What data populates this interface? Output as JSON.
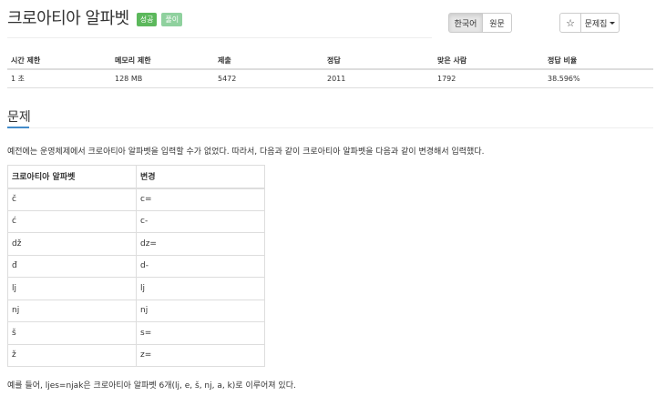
{
  "problem": {
    "title": "크로아티아 알파벳",
    "badges": {
      "success": "성공",
      "solved": "풀이"
    }
  },
  "language": {
    "active": "한국어",
    "original": "원문"
  },
  "tools": {
    "star_icon": "☆",
    "problem_set_label": "문제집"
  },
  "info": {
    "headers": [
      "시간 제한",
      "메모리 제한",
      "제출",
      "정답",
      "맞은 사람",
      "정답 비율"
    ],
    "values": [
      "1 초",
      "128 MB",
      "5472",
      "2011",
      "1792",
      "38.596%"
    ]
  },
  "section": {
    "title": "문제"
  },
  "description": "예전에는 운영체제에서 크로아티아 알파벳을 입력할 수가 없었다. 따라서, 다음과 같이 크로아티아 알파벳을 다음과 같이 변경해서 입력했다.",
  "alphabet_table": {
    "headers": [
      "크로아티아 알파벳",
      "변경"
    ],
    "rows": [
      [
        "č",
        "c="
      ],
      [
        "ć",
        "c-"
      ],
      [
        "dž",
        "dz="
      ],
      [
        "đ",
        "d-"
      ],
      [
        "lj",
        "lj"
      ],
      [
        "nj",
        "nj"
      ],
      [
        "š",
        "s="
      ],
      [
        "ž",
        "z="
      ]
    ]
  },
  "example_text": "예를 들어, ljes=njak은 크로아티아 알파벳 6개(lj, e, š, nj, a, k)로 이루어져 있다.",
  "colors": {
    "success_badge": "#5cb85c",
    "solved_badge": "#8fd19e",
    "accent_underline": "#428bca"
  }
}
